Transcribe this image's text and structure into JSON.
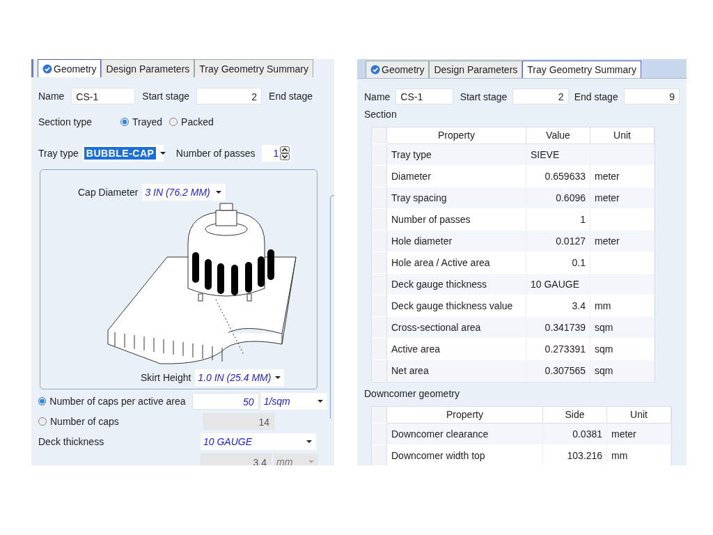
{
  "left_panel": {
    "tabs": [
      {
        "label": "Geometry",
        "selected": true,
        "complete": true
      },
      {
        "label": "Design Parameters",
        "selected": false,
        "complete": false
      },
      {
        "label": "Tray Geometry Summary",
        "selected": false,
        "complete": false
      }
    ],
    "name": {
      "label": "Name",
      "value": "CS-1"
    },
    "start_stage": {
      "label": "Start stage",
      "value": "2"
    },
    "end_stage": {
      "label": "End stage"
    },
    "section_type": {
      "label": "Section type",
      "options": [
        {
          "label": "Trayed",
          "selected": true
        },
        {
          "label": "Packed",
          "selected": false
        }
      ]
    },
    "tray_type": {
      "label": "Tray type",
      "value": "BUBBLE-CAP"
    },
    "number_of_passes": {
      "label": "Number of passes",
      "value": "1"
    },
    "cap_diameter": {
      "label": "Cap Diameter",
      "value": "3 IN (76.2 MM)"
    },
    "skirt_height": {
      "label": "Skirt Height",
      "value": "1.0 IN (25.4 MM)"
    },
    "cap_count_options": [
      {
        "label": "Number of caps per active area",
        "selected": true,
        "value": "50",
        "unit": "1/sqm"
      },
      {
        "label": "Number of caps",
        "selected": false,
        "value": "14"
      }
    ],
    "deck_thickness": {
      "label": "Deck thickness",
      "value": "10 GAUGE"
    },
    "deck_thickness_value": {
      "value": "3.4",
      "unit": "mm"
    }
  },
  "right_panel": {
    "tabs": [
      {
        "label": "Geometry",
        "selected": false,
        "complete": true
      },
      {
        "label": "Design Parameters",
        "selected": false,
        "complete": false
      },
      {
        "label": "Tray Geometry Summary",
        "selected": true,
        "complete": false
      }
    ],
    "name": {
      "label": "Name",
      "value": "CS-1"
    },
    "start_stage": {
      "label": "Start stage",
      "value": "2"
    },
    "end_stage": {
      "label": "End stage",
      "value": "9"
    },
    "section": {
      "title": "Section",
      "columns": [
        "Property",
        "Value",
        "Unit"
      ],
      "rows": [
        [
          "Tray type",
          "SIEVE",
          ""
        ],
        [
          "Diameter",
          "0.659633",
          "meter"
        ],
        [
          "Tray spacing",
          "0.6096",
          "meter"
        ],
        [
          "Number of passes",
          "1",
          ""
        ],
        [
          "Hole diameter",
          "0.0127",
          "meter"
        ],
        [
          "Hole area / Active area",
          "0.1",
          ""
        ],
        [
          "Deck gauge thickness",
          "10 GAUGE",
          ""
        ],
        [
          "Deck gauge thickness value",
          "3.4",
          "mm"
        ],
        [
          "Cross-sectional area",
          "0.341739",
          "sqm"
        ],
        [
          "Active area",
          "0.273391",
          "sqm"
        ],
        [
          "Net area",
          "0.307565",
          "sqm"
        ]
      ]
    },
    "downcomer": {
      "title": "Downcomer geometry",
      "columns": [
        "Property",
        "Side",
        "Unit"
      ],
      "rows": [
        [
          "Downcomer clearance",
          "0.0381",
          "meter"
        ],
        [
          "Downcomer width top",
          "103.216",
          "mm"
        ]
      ]
    }
  }
}
